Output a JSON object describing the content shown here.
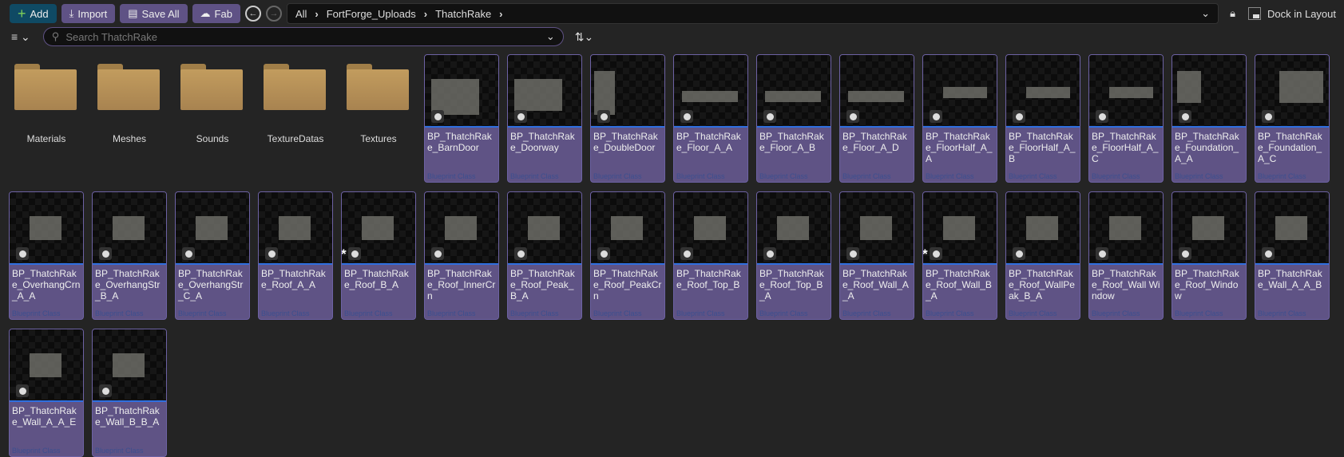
{
  "toolbar": {
    "add": "Add",
    "import": "Import",
    "save_all": "Save All",
    "fab": "Fab",
    "dock": "Dock in Layout"
  },
  "breadcrumb": [
    "All",
    "FortForge_Uploads",
    "ThatchRake"
  ],
  "search": {
    "placeholder": "Search ThatchRake",
    "value": ""
  },
  "folders": [
    "Materials",
    "Meshes",
    "Sounds",
    "TextureDatas",
    "Textures"
  ],
  "asset_type": "Blueprint Class",
  "assets": [
    {
      "name": "BP_ThatchRake_BarnDoor",
      "modified": false
    },
    {
      "name": "BP_ThatchRake_Doorway",
      "modified": false
    },
    {
      "name": "BP_ThatchRake_DoubleDoor",
      "modified": false
    },
    {
      "name": "BP_ThatchRake_Floor_A_A",
      "modified": false
    },
    {
      "name": "BP_ThatchRake_Floor_A_B",
      "modified": false
    },
    {
      "name": "BP_ThatchRake_Floor_A_D",
      "modified": false
    },
    {
      "name": "BP_ThatchRake_FloorHalf_A_A",
      "modified": false
    },
    {
      "name": "BP_ThatchRake_FloorHalf_A_B",
      "modified": false
    },
    {
      "name": "BP_ThatchRake_FloorHalf_A_C",
      "modified": false
    },
    {
      "name": "BP_ThatchRake_Foundation_A_A",
      "modified": false
    },
    {
      "name": "BP_ThatchRake_Foundation_A_C",
      "modified": false
    },
    {
      "name": "BP_ThatchRake_OverhangCrn_A_A",
      "modified": false
    },
    {
      "name": "BP_ThatchRake_OverhangStr_B_A",
      "modified": false
    },
    {
      "name": "BP_ThatchRake_OverhangStr_C_A",
      "modified": false
    },
    {
      "name": "BP_ThatchRake_Roof_A_A",
      "modified": false
    },
    {
      "name": "BP_ThatchRake_Roof_B_A",
      "modified": true
    },
    {
      "name": "BP_ThatchRake_Roof_InnerCrn",
      "modified": false
    },
    {
      "name": "BP_ThatchRake_Roof_Peak_B_A",
      "modified": false
    },
    {
      "name": "BP_ThatchRake_Roof_PeakCrn",
      "modified": false
    },
    {
      "name": "BP_ThatchRake_Roof_Top_B",
      "modified": false
    },
    {
      "name": "BP_ThatchRake_Roof_Top_B_A",
      "modified": false
    },
    {
      "name": "BP_ThatchRake_Roof_Wall_A_A",
      "modified": false
    },
    {
      "name": "BP_ThatchRake_Roof_Wall_B_A",
      "modified": true
    },
    {
      "name": "BP_ThatchRake_Roof_WallPeak_B_A",
      "modified": false
    },
    {
      "name": "BP_ThatchRake_Roof_Wall Window",
      "modified": false
    },
    {
      "name": "BP_ThatchRake_Roof_Window",
      "modified": false
    },
    {
      "name": "BP_ThatchRake_Wall_A_A_B",
      "modified": false
    },
    {
      "name": "BP_ThatchRake_Wall_A_A_E",
      "modified": false
    },
    {
      "name": "BP_ThatchRake_Wall_B_B_A",
      "modified": false
    }
  ],
  "colors": {
    "accent": "#5f5285",
    "add": "#0f4a64",
    "selection": "#2f6fe0"
  }
}
